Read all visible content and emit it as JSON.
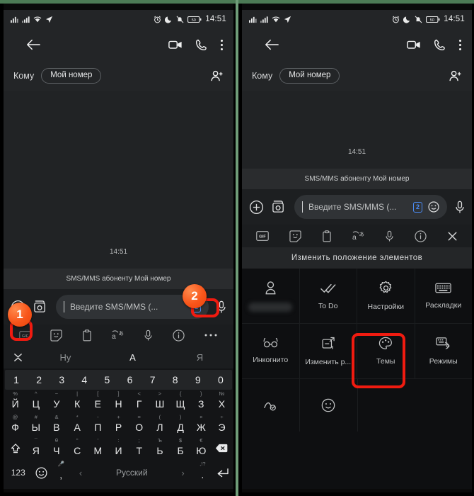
{
  "meta": {
    "accent_red": "#f01b10",
    "accent_orange": "#f8551a",
    "frame_green": "#6f9c78"
  },
  "status_bar": {
    "time": "14:51",
    "left_icons": [
      "signal-bars-icon",
      "signal-bars-icon",
      "wifi-icon",
      "location-icon"
    ],
    "right_icons": [
      "alarm-icon",
      "do-not-disturb-moon-icon",
      "mute-bell-icon",
      "battery-icon"
    ],
    "battery_level": "50"
  },
  "app_bar": {
    "back": "back-arrow-icon",
    "video_call": "video-camera-icon",
    "voice_call": "phone-icon",
    "overflow": "more-vertical-icon"
  },
  "recipient_row": {
    "label": "Кому",
    "chip": "Мой номер",
    "add_contact": "add-person-icon"
  },
  "conversation": {
    "timestamp": "14:51",
    "system_note": "SMS/MMS абоненту Мой номер"
  },
  "compose": {
    "attach": "plus-circle-icon",
    "gallery": "image-camera-icon",
    "placeholder": "Введите SMS/MMS (...",
    "sim_badge": "2",
    "emoji": "smiley-icon",
    "mic": "microphone-icon"
  },
  "left_panel": {
    "keyboard_toolbar": [
      {
        "name": "gif-icon",
        "label": "GIF"
      },
      {
        "name": "sticker-icon",
        "label": ""
      },
      {
        "name": "clipboard-icon",
        "label": ""
      },
      {
        "name": "translate-icon",
        "label": ""
      },
      {
        "name": "microphone-icon",
        "label": ""
      },
      {
        "name": "info-icon",
        "label": ""
      },
      {
        "name": "more-horizontal-icon",
        "label": "•••"
      }
    ],
    "suggestions": {
      "collapse": "collapse-chevron-icon",
      "items": [
        "Ну",
        "А",
        "Я"
      ],
      "selected_index": 1
    },
    "keyboard": {
      "number_row": [
        "1",
        "2",
        "3",
        "4",
        "5",
        "6",
        "7",
        "8",
        "9",
        "0"
      ],
      "rows": [
        {
          "keys": [
            {
              "sup": "%",
              "main": "Й"
            },
            {
              "sup": "^",
              "main": "Ц"
            },
            {
              "sup": "~",
              "main": "У"
            },
            {
              "sup": "|",
              "main": "К"
            },
            {
              "sup": "[",
              "main": "Е"
            },
            {
              "sup": "]",
              "main": "Н"
            },
            {
              "sup": "<",
              "main": "Г"
            },
            {
              "sup": ">",
              "main": "Ш"
            },
            {
              "sup": "{",
              "main": "Щ"
            },
            {
              "sup": "}",
              "main": "З"
            },
            {
              "sup": "№",
              "main": "Х"
            }
          ]
        },
        {
          "keys": [
            {
              "sup": "@",
              "main": "Ф"
            },
            {
              "sup": "#",
              "main": "Ы"
            },
            {
              "sup": "&",
              "main": "В"
            },
            {
              "sup": "*",
              "main": "А"
            },
            {
              "sup": "-",
              "main": "П"
            },
            {
              "sup": "+",
              "main": "Р"
            },
            {
              "sup": "=",
              "main": "О"
            },
            {
              "sup": "(",
              "main": "Л"
            },
            {
              "sup": ")",
              "main": "Д"
            },
            {
              "sup": "×",
              "main": "Ж"
            },
            {
              "sup": "÷",
              "main": "Э"
            }
          ]
        },
        {
          "keys": [
            {
              "sup": "",
              "main": "shift-icon"
            },
            {
              "sup": "¯",
              "main": "Я"
            },
            {
              "sup": "θ",
              "main": "Ч"
            },
            {
              "sup": "\"",
              "main": "С"
            },
            {
              "sup": "'",
              "main": "М"
            },
            {
              "sup": ":",
              "main": "И"
            },
            {
              "sup": ";",
              "main": "Т"
            },
            {
              "sup": "Ъ",
              "main": "Ь"
            },
            {
              "sup": "$",
              "main": "Б"
            },
            {
              "sup": "€",
              "main": "Ю"
            },
            {
              "sup": "",
              "main": "backspace-icon"
            }
          ]
        }
      ],
      "bottom_row": {
        "numeric": "123",
        "emoji": "smiley-icon",
        "comma": ",",
        "comma_sup": "microphone-icon",
        "prev": "‹",
        "space": "Русский",
        "next": "›",
        "period": ".",
        "period_sup": ",!?",
        "enter": "enter-icon"
      }
    },
    "markers": [
      {
        "number": "1",
        "target": "collapse-suggestions-button"
      },
      {
        "number": "2",
        "target": "keyboard-more-options-button"
      }
    ]
  },
  "right_panel": {
    "keyboard_toolbar": [
      {
        "name": "gif-icon",
        "label": "GIF"
      },
      {
        "name": "sticker-icon",
        "label": ""
      },
      {
        "name": "clipboard-icon",
        "label": ""
      },
      {
        "name": "translate-icon",
        "label": ""
      },
      {
        "name": "microphone-icon",
        "label": ""
      },
      {
        "name": "info-icon",
        "label": ""
      },
      {
        "name": "close-icon",
        "label": "✕"
      }
    ],
    "menu_title": "Изменить положение элементов",
    "menu_items": [
      {
        "label": "",
        "icon": "person-icon",
        "redacted": true,
        "highlighted": false
      },
      {
        "label": "To Do",
        "icon": "double-check-icon",
        "redacted": false,
        "highlighted": false
      },
      {
        "label": "Настройки",
        "icon": "gear-icon",
        "redacted": false,
        "highlighted": true
      },
      {
        "label": "Раскладки",
        "icon": "keyboard-icon",
        "redacted": false,
        "highlighted": false
      },
      {
        "label": "Инкогнито",
        "icon": "glasses-icon",
        "redacted": false,
        "highlighted": false
      },
      {
        "label": "Изменить р...",
        "icon": "resize-icon",
        "redacted": false,
        "highlighted": false
      },
      {
        "label": "Темы",
        "icon": "palette-icon",
        "redacted": false,
        "highlighted": false
      },
      {
        "label": "Режимы",
        "icon": "modes-icon",
        "redacted": false,
        "highlighted": false
      },
      {
        "label": "",
        "icon": "handwriting-icon",
        "redacted": false,
        "highlighted": false
      },
      {
        "label": "",
        "icon": "emoji-icon",
        "redacted": false,
        "highlighted": false
      }
    ]
  }
}
